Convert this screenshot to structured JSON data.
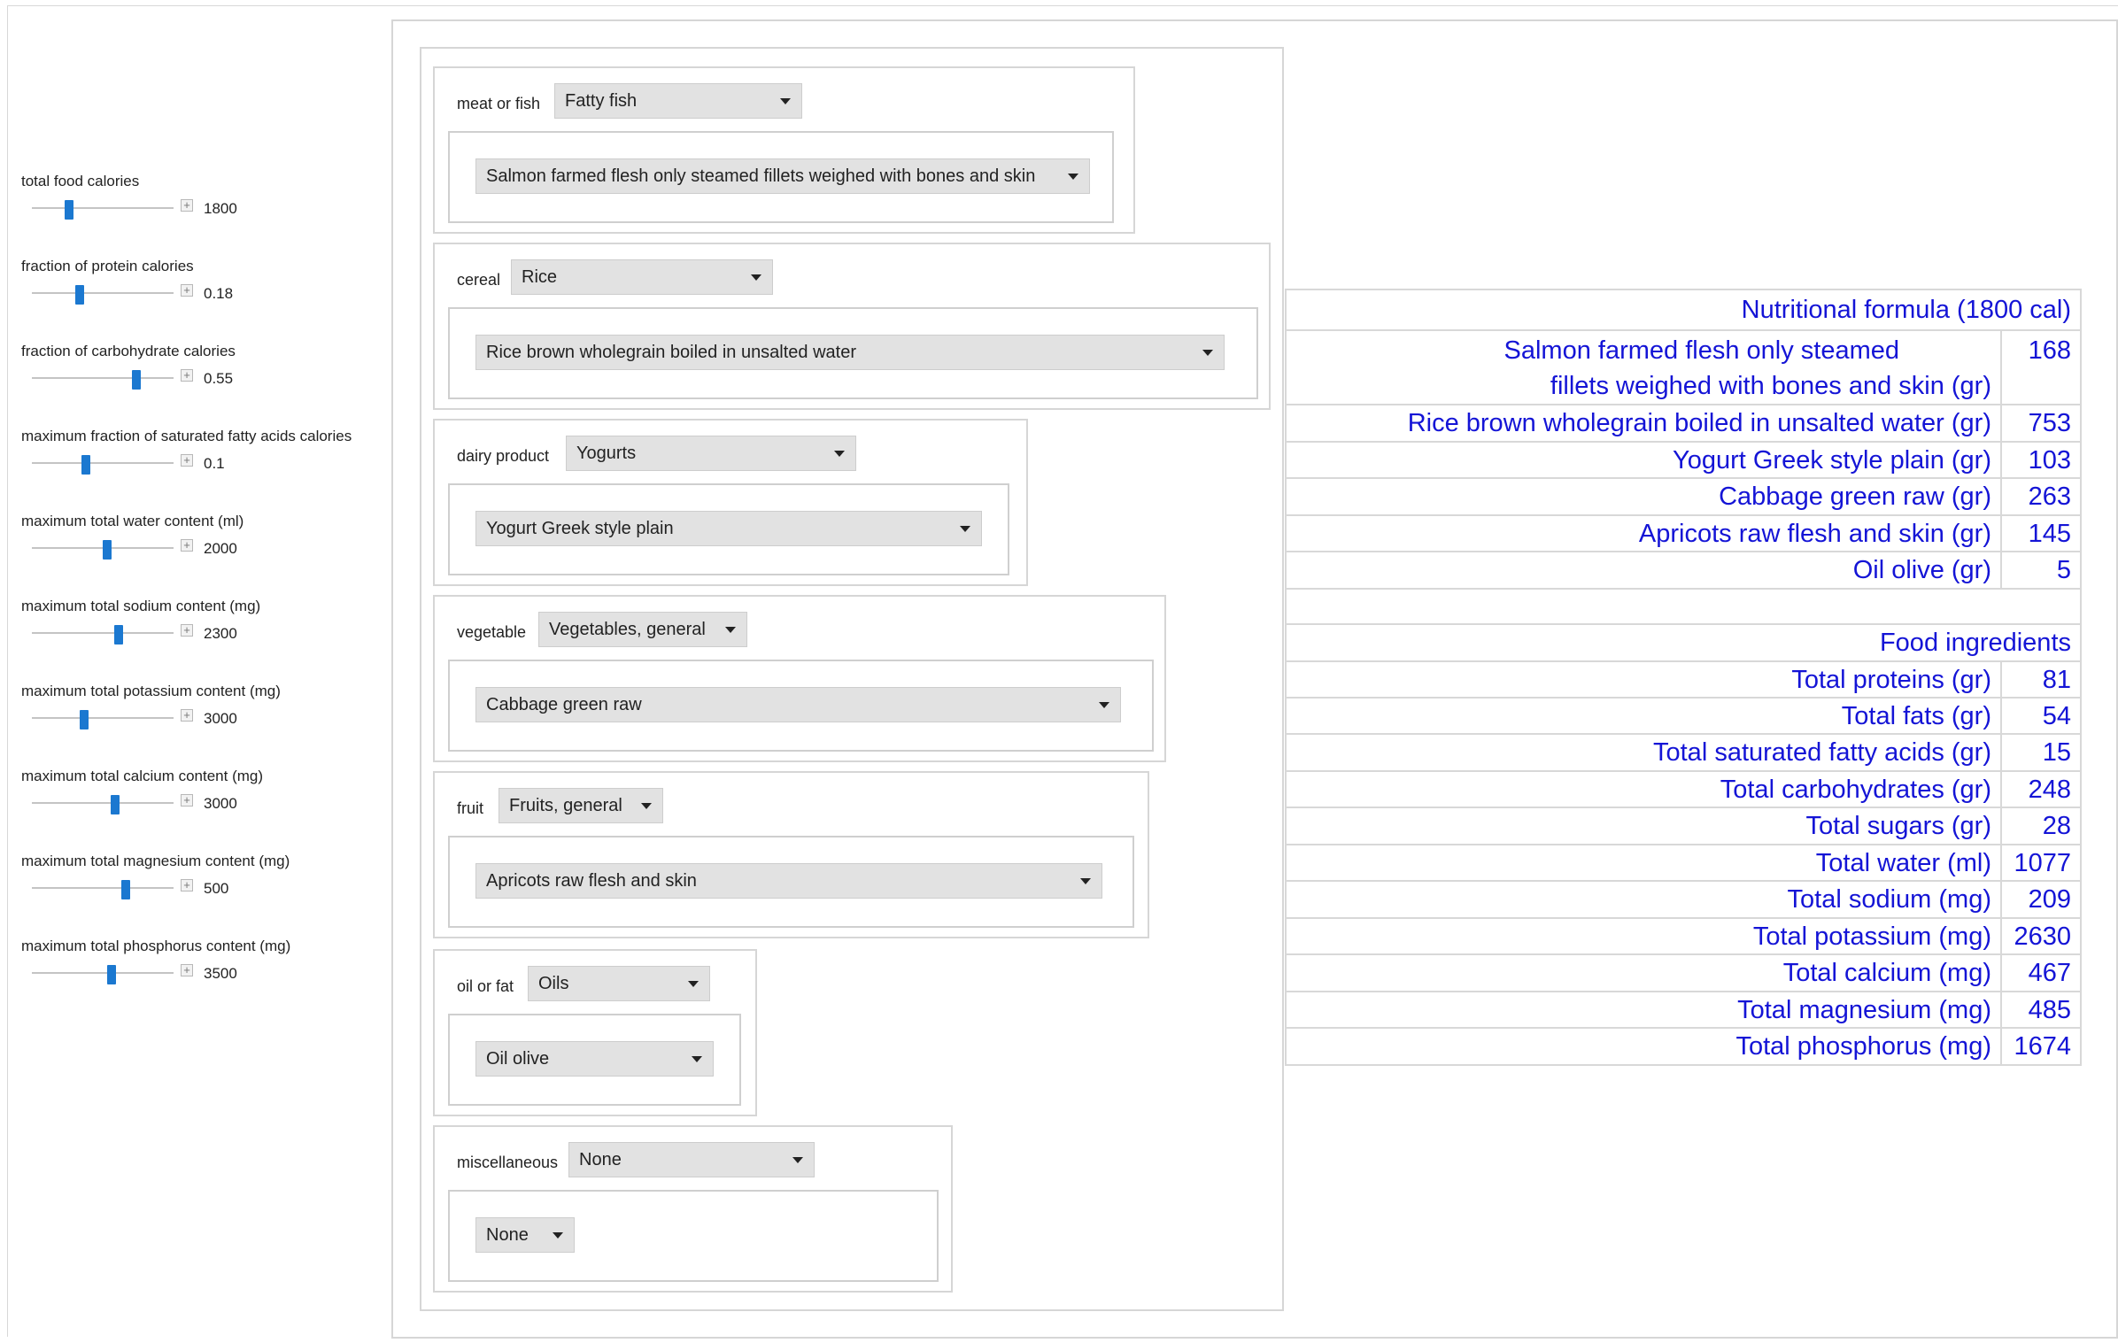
{
  "controls": {
    "sliders": [
      {
        "label": "total food calories",
        "value": "1800",
        "fraction": 0.26
      },
      {
        "label": "fraction of protein calories",
        "value": "0.18",
        "fraction": 0.34
      },
      {
        "label": "fraction of carbohydrate calories",
        "value": "0.55",
        "fraction": 0.74
      },
      {
        "label": "maximum fraction of saturated  fatty acids calories",
        "value": "0.1",
        "fraction": 0.38
      },
      {
        "label": "maximum total water content (ml)",
        "value": "2000",
        "fraction": 0.53
      },
      {
        "label": "maximum total sodium content (mg)",
        "value": "2300",
        "fraction": 0.61
      },
      {
        "label": "maximum total potassium content (mg)",
        "value": "3000",
        "fraction": 0.37
      },
      {
        "label": "maximum total calcium content (mg)",
        "value": "3000",
        "fraction": 0.59
      },
      {
        "label": "maximum total magnesium content (mg)",
        "value": "500",
        "fraction": 0.66
      },
      {
        "label": "maximum total phosphorus content (mg)",
        "value": "3500",
        "fraction": 0.56
      }
    ],
    "plus_glyph": "+"
  },
  "categories": [
    {
      "label": "meat or fish",
      "group": "Fatty fish",
      "item": "Salmon farmed flesh only steamed fillets weighed with bones and skin"
    },
    {
      "label": "cereal",
      "group": "Rice",
      "item": "Rice brown wholegrain boiled in unsalted water"
    },
    {
      "label": "dairy product",
      "group": "Yogurts",
      "item": "Yogurt Greek style plain"
    },
    {
      "label": "vegetable",
      "group": "Vegetables, general",
      "item": "Cabbage green raw"
    },
    {
      "label": "fruit",
      "group": "Fruits, general",
      "item": "Apricots raw flesh and skin"
    },
    {
      "label": "oil or fat",
      "group": "Oils",
      "item": "Oil olive"
    },
    {
      "label": "miscellaneous",
      "group": "None",
      "item": "None"
    }
  ],
  "results": {
    "formula_title": "Nutritional formula (1800 cal)",
    "formula_rows": [
      {
        "name_line1": "Salmon farmed flesh only steamed",
        "name_line2": "fillets weighed with bones and skin (gr)",
        "value": "168"
      },
      {
        "name": "Rice brown wholegrain boiled in unsalted water (gr)",
        "value": "753"
      },
      {
        "name": "Yogurt Greek style plain (gr)",
        "value": "103"
      },
      {
        "name": "Cabbage green raw (gr)",
        "value": "263"
      },
      {
        "name": "Apricots raw flesh and skin (gr)",
        "value": "145"
      },
      {
        "name": "Oil olive (gr)",
        "value": "5"
      }
    ],
    "ingredients_title": "Food ingredients",
    "ingredient_rows": [
      {
        "name": "Total proteins (gr)",
        "value": "81"
      },
      {
        "name": "Total fats (gr)",
        "value": "54"
      },
      {
        "name": "Total saturated fatty acids (gr)",
        "value": "15"
      },
      {
        "name": "Total carbohydrates (gr)",
        "value": "248"
      },
      {
        "name": "Total sugars (gr)",
        "value": "28"
      },
      {
        "name": "Total water (ml)",
        "value": "1077"
      },
      {
        "name": "Total sodium (mg)",
        "value": "209"
      },
      {
        "name": "Total potassium (mg)",
        "value": "2630"
      },
      {
        "name": "Total calcium (mg)",
        "value": "467"
      },
      {
        "name": "Total magnesium (mg)",
        "value": "485"
      },
      {
        "name": "Total phosphorus (mg)",
        "value": "1674"
      }
    ]
  },
  "colors": {
    "slider_thumb": "#1b78d0",
    "result_text": "#1414d6"
  }
}
